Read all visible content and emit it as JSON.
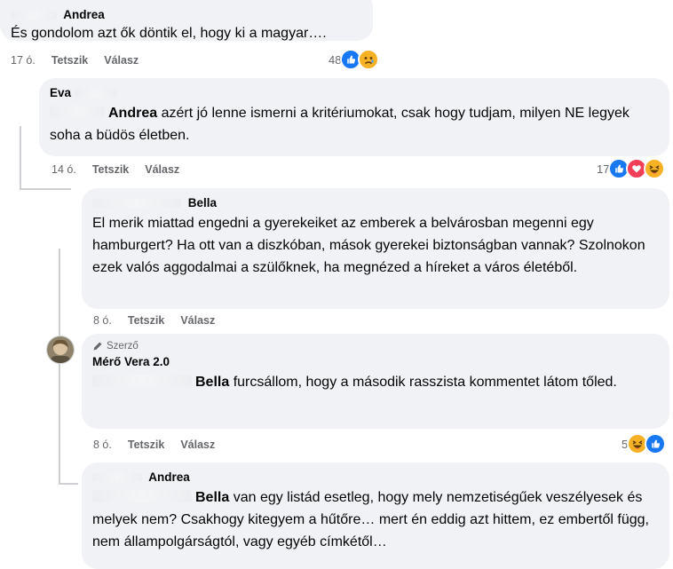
{
  "comments": [
    {
      "id": "c1",
      "author": "Andrea",
      "text": "És gondolom azt ők döntik el, hogy ki a magyar….",
      "time": "17 ó.",
      "like_label": "Tetszik",
      "reply_label": "Válasz",
      "reaction_count": "48",
      "reactions": [
        "like-icon",
        "sad-icon"
      ]
    },
    {
      "id": "c2",
      "author": "Eva",
      "mention": "Andrea",
      "text": " azért jó lenne ismerni a kritériumokat, csak hogy tudjam, milyen NE legyek soha a büdös életben.",
      "time": "14 ó.",
      "like_label": "Tetszik",
      "reply_label": "Válasz",
      "reaction_count": "17",
      "reactions": [
        "like-icon",
        "love-icon",
        "haha-icon"
      ]
    },
    {
      "id": "c3",
      "author": "Bella",
      "text": "El merik miattad engedni a gyerekeiket az emberek a belvárosban megenni egy hamburgert? Ha ott van a diszkóban, mások gyerekei biztonságban vannak? Szolnokon ezek valós aggodalmai a szülőknek, ha megnézed a híreket a város életéből.",
      "time": "8 ó.",
      "like_label": "Tetszik",
      "reply_label": "Válasz"
    },
    {
      "id": "c4",
      "badge": "Szerző",
      "author": "Mérő Vera 2.0",
      "mention": "Bella",
      "text": " furcsállom, hogy a második rasszista kommentet látom tőled.",
      "time": "8 ó.",
      "like_label": "Tetszik",
      "reply_label": "Válasz",
      "reaction_count": "5",
      "reactions": [
        "haha-icon",
        "like-icon"
      ]
    },
    {
      "id": "c5",
      "author": "Andrea",
      "mention": "Bella",
      "text": " van egy listád esetleg, hogy mely nemzetiségűek veszélyesek és melyek nem? Csakhogy kitegyem a hűtőre… mert én eddig azt hittem, ez embertől függ, nem állampolgárságtól, vagy egyéb címkétől…"
    }
  ],
  "colors": {
    "bubble": "#f0f2f5",
    "meta": "#65676b",
    "like": "#1877f2",
    "love": "#f33e58",
    "haha": "#f7b125"
  }
}
